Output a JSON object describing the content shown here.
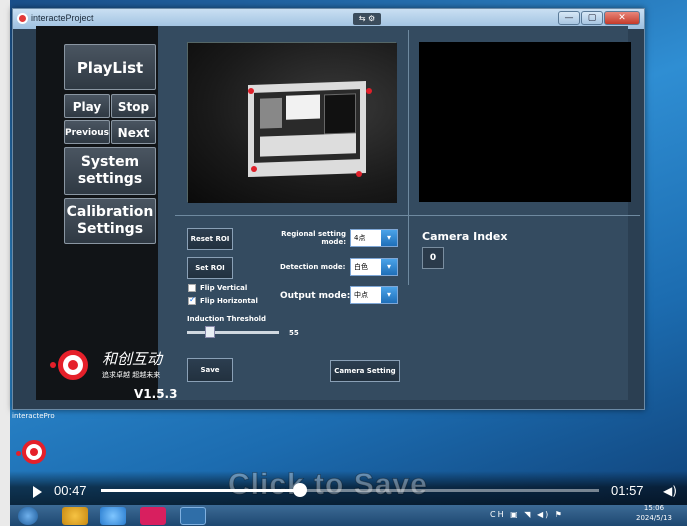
{
  "window": {
    "title": "interacteProject",
    "center_tag": "⇆ ⚙",
    "controls": [
      "—",
      "▢",
      "✕"
    ]
  },
  "sidebar": {
    "playlist": "PlayList",
    "play": "Play",
    "stop": "Stop",
    "previous": "Previous",
    "next": "Next",
    "system_settings_1": "System",
    "system_settings_2": "settings",
    "calibration_1": "Calibration",
    "calibration_2": "Settings",
    "logo_text": "和创互动",
    "logo_sub": "追求卓越 超越未来",
    "version": "V1.5.3"
  },
  "controls": {
    "reset_roi": "Reset ROI",
    "set_roi": "Set ROI",
    "flip_vertical": "Flip Vertical",
    "flip_horizontal": "Flip Horizontal",
    "flip_vertical_checked": false,
    "flip_horizontal_checked": true,
    "induction_threshold_label": "Induction Threshold",
    "induction_threshold_value": "55",
    "regional_mode_label_1": "Regional setting",
    "regional_mode_label_2": "mode:",
    "regional_mode_value": "4点",
    "detection_mode_label": "Detection mode:",
    "detection_mode_value": "白色",
    "output_mode_label": "Output mode:",
    "output_mode_value": "中点",
    "save": "Save",
    "camera_setting": "Camera Setting",
    "camera_index_label": "Camera Index",
    "camera_index_value": "0"
  },
  "desktop": {
    "icon_label": "interactePro"
  },
  "player": {
    "current_time": "00:47",
    "total_time": "01:57",
    "progress": 0.4,
    "watermark": "Click to Save"
  },
  "taskbar": {
    "time": "15:06",
    "date": "2024/5/13",
    "tray": "CH ▣ ◥ ◀) ⚑"
  },
  "colors": {
    "app_bg": "#344b60",
    "sidebar_bg": "#111417",
    "accent_red": "#e5202a",
    "dropdown_arrow": "#1f6fb8"
  }
}
